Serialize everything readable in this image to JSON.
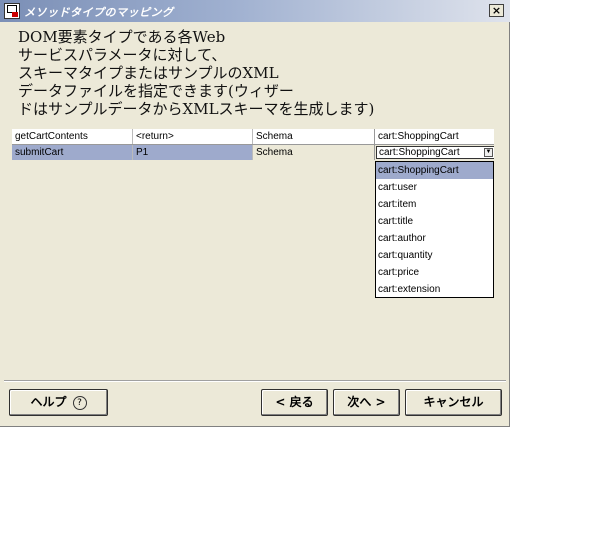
{
  "window": {
    "title": "メソッドタイプのマッピング",
    "close_label": "×"
  },
  "description": {
    "lines": [
      "DOM要素タイプである各Web",
      "サービスパラメータに対して、",
      "スキーマタイプまたはサンプルのXML",
      "データファイルを指定できます(ウィザー",
      "ドはサンプルデータからXMLスキーマを生成します)"
    ]
  },
  "table": {
    "rows": [
      {
        "method": "getCartContents",
        "parameter": "<return>",
        "kind": "Schema",
        "type": "cart:ShoppingCart"
      },
      {
        "method": "submitCart",
        "parameter": "P1",
        "kind": "Schema",
        "type": "cart:ShoppingCart"
      }
    ]
  },
  "type_dropdown": {
    "selected": "cart:ShoppingCart",
    "options": [
      "cart:ShoppingCart",
      "cart:user",
      "cart:item",
      "cart:title",
      "cart:author",
      "cart:quantity",
      "cart:price",
      "cart:extension"
    ]
  },
  "buttons": {
    "help": "ヘルプ",
    "help_icon": "?",
    "back": "< 戻る",
    "next": "次へ >",
    "cancel": "キャンセル"
  }
}
